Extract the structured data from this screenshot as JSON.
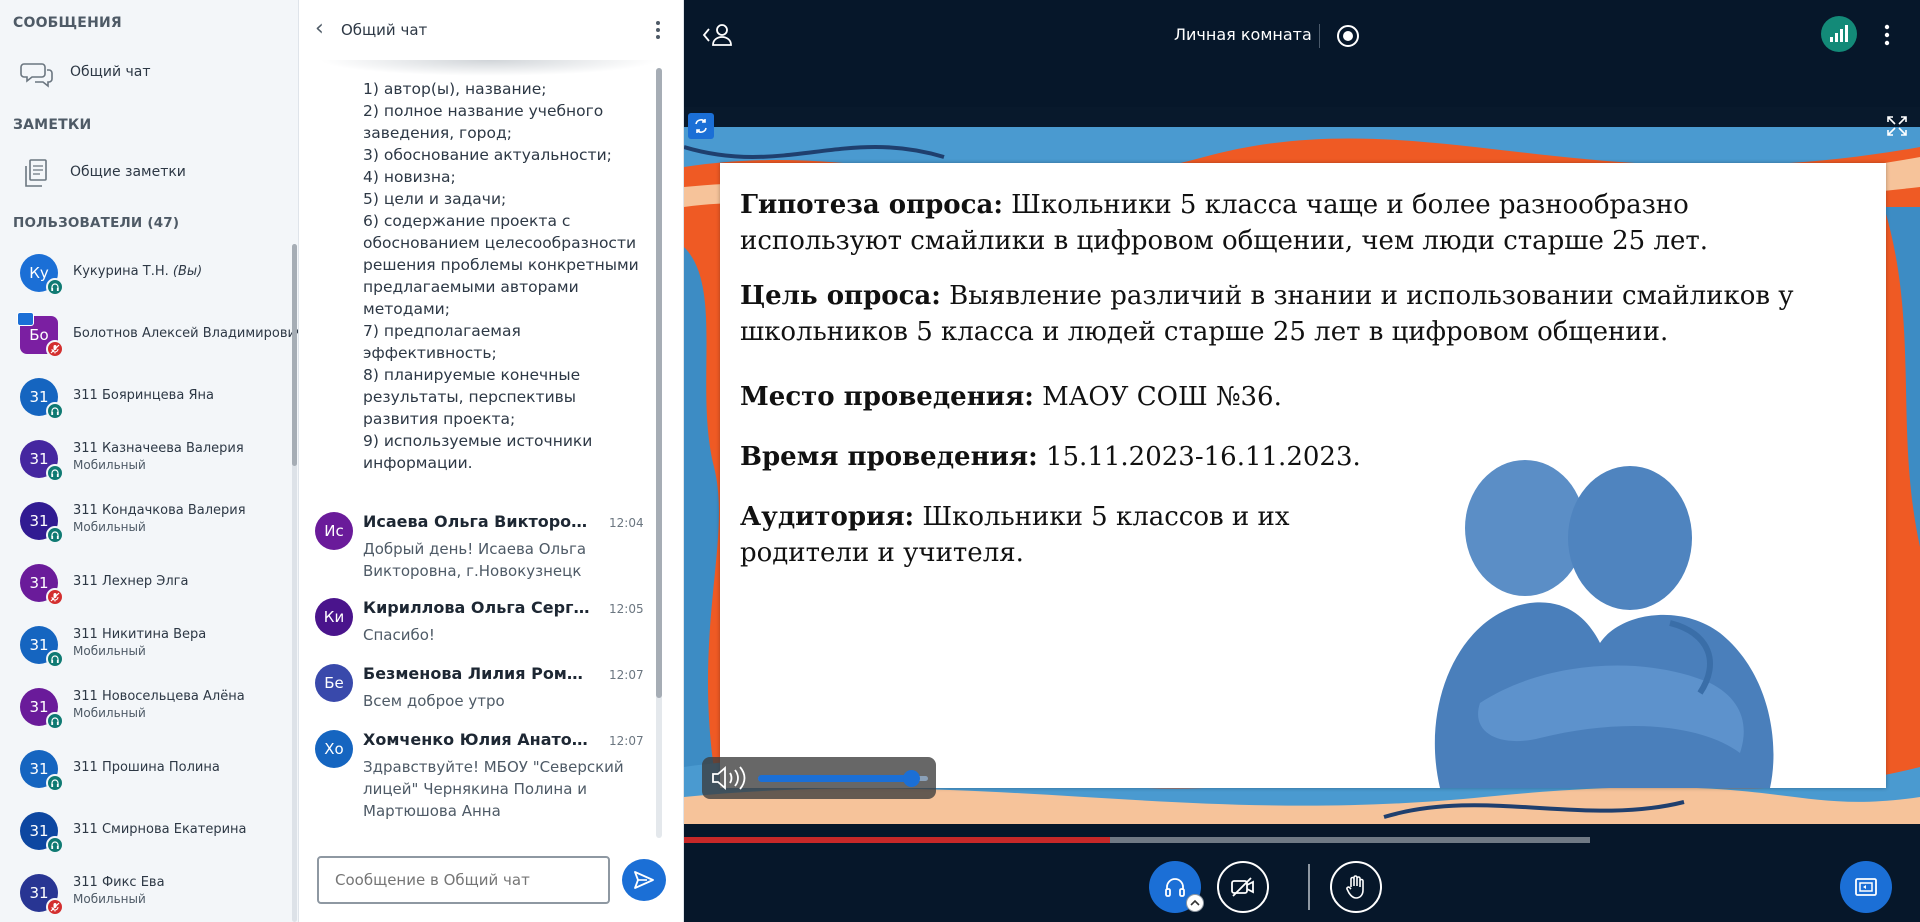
{
  "sidebar": {
    "messages_title": "СООБЩЕНИЯ",
    "public_chat": "Общий чат",
    "notes_title": "ЗАМЕТКИ",
    "shared_notes": "Общие заметки",
    "users_title": "ПОЛЬЗОВАТЕЛИ (47)",
    "users": [
      {
        "initials": "Ку",
        "name": "Кукурина Т.Н.",
        "you": "(Вы)",
        "sub": "",
        "color": "#1b6fd6",
        "status": "audio"
      },
      {
        "initials": "Бо",
        "name": "Болотнов Алексей Владимирович",
        "you": "",
        "sub": "",
        "color": "#7b1fa2",
        "status": "muted",
        "presenter": true
      },
      {
        "initials": "31",
        "name": "311 Бояринцева Яна",
        "you": "",
        "sub": "",
        "color": "#1565c0",
        "status": "audio"
      },
      {
        "initials": "31",
        "name": "311 Казначеева Валерия",
        "you": "",
        "sub": "Мобильный",
        "color": "#4527a0",
        "status": "audio"
      },
      {
        "initials": "31",
        "name": "311 Кондачкова Валерия",
        "you": "",
        "sub": "Мобильный",
        "color": "#311b92",
        "status": "audio"
      },
      {
        "initials": "31",
        "name": "311 Лехнер Элга",
        "you": "",
        "sub": "",
        "color": "#6a1b9a",
        "status": "muted"
      },
      {
        "initials": "31",
        "name": "311 Никитина Вера",
        "you": "",
        "sub": "Мобильный",
        "color": "#1565c0",
        "status": "audio"
      },
      {
        "initials": "31",
        "name": "311 Новосельцева Алёна",
        "you": "",
        "sub": "Мобильный",
        "color": "#6a1b9a",
        "status": "audio"
      },
      {
        "initials": "31",
        "name": "311 Прошина Полина",
        "you": "",
        "sub": "",
        "color": "#1565c0",
        "status": "audio"
      },
      {
        "initials": "31",
        "name": "311 Смирнова Екатерина",
        "you": "",
        "sub": "",
        "color": "#0d47a1",
        "status": "audio"
      },
      {
        "initials": "31",
        "name": "311 Фикс Ева",
        "you": "",
        "sub": "Мобильный",
        "color": "#283593",
        "status": "muted"
      }
    ]
  },
  "chat": {
    "title": "Общий чат",
    "bulk_text": "1) автор(ы), название;\n2) полное название учебного заведения, город;\n3) обоснование актуальности;\n4) новизна;\n5) цели и задачи;\n6) содержание проекта с обоснованием целесообразности решения проблемы конкретными предлагаемыми авторами методами;\n7) предполагаемая эффективность;\n8) планируемые конечные результаты, перспективы развития проекта;\n9) используемые источники информации.",
    "messages": [
      {
        "initials": "Ис",
        "name": "Исаева Ольга Викторовна",
        "time": "12:04",
        "text": "Добрый день! Исаева Ольга Викторовна, г.Новокузнецк",
        "color": "#6a1b9a"
      },
      {
        "initials": "Ки",
        "name": "Кириллова Ольга Сергеевна",
        "time": "12:05",
        "text": "Спасибо!",
        "color": "#4a148c"
      },
      {
        "initials": "Бе",
        "name": "Безменова Лилия Романовна",
        "time": "12:07",
        "text": "Всем доброе утро",
        "color": "#3949ab"
      },
      {
        "initials": "Хо",
        "name": "Хомченко Юлия Анатольевна",
        "time": "12:07",
        "text": "Здравствуйте! МБОУ \"Северский лицей\" Чернякина Полина и Мартюшова Анна",
        "color": "#1565c0"
      }
    ],
    "input_placeholder": "Сообщение в Общий чат"
  },
  "main": {
    "room_title": "Личная комната",
    "slide": [
      {
        "label": "Гипотеза опроса:",
        "text": " Школьники 5 класса чаще и более разнообразно используют смайлики в цифровом общении, чем люди старше 25 лет."
      },
      {
        "label": "Цель опроса:",
        "text": " Выявление различий в знании и использовании смайликов у школьников 5 класса и людей старше 25 лет в цифровом общении."
      },
      {
        "label": "Место проведения:",
        "text": " МАОУ СОШ №36."
      },
      {
        "label": "Время проведения:",
        "text": " 15.11.2023-16.11.2023."
      },
      {
        "label": "Аудитория:",
        "text": " Школьники 5 классов и их родители и учителя."
      }
    ],
    "volume_level": 0.9,
    "playback_progress": 0.47
  },
  "colors": {
    "accent": "#1b6fd6",
    "main_bg": "#06172a",
    "connection": "#138a78",
    "muted": "#d32f2f"
  },
  "icons": [
    "chat-icon",
    "notes-icon",
    "headset-icon",
    "mic-muted-icon",
    "presenter-icon",
    "send-icon",
    "user-list-icon",
    "record-icon",
    "signal-icon",
    "swap-icon",
    "fullscreen-icon",
    "volume-icon",
    "video-off-icon",
    "raise-hand-icon",
    "layout-icon"
  ]
}
